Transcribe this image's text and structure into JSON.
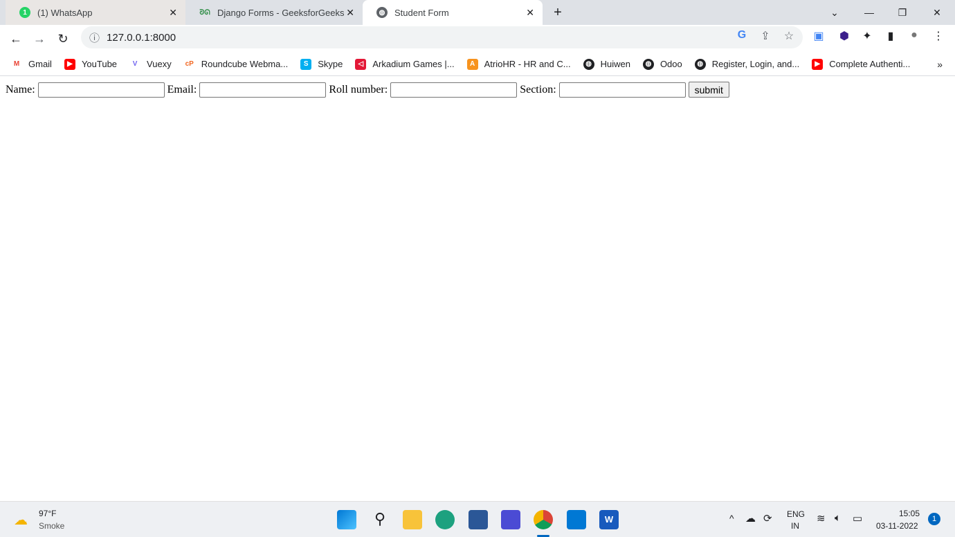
{
  "tabs": [
    {
      "title": "(1) WhatsApp",
      "icon": "whatsapp-icon",
      "badge": "1"
    },
    {
      "title": "Django Forms - GeeksforGeeks",
      "icon": "gfg-icon"
    },
    {
      "title": "Student Form",
      "icon": "globe-icon",
      "active": true
    }
  ],
  "address": {
    "url": "127.0.0.1:8000"
  },
  "bookmarks": [
    {
      "label": "Gmail",
      "color": "#ea4335",
      "glyph": "M"
    },
    {
      "label": "YouTube",
      "color": "#ff0000",
      "glyph": "▶"
    },
    {
      "label": "Vuexy",
      "color": "#7367f0",
      "glyph": "V"
    },
    {
      "label": "Roundcube Webma...",
      "color": "#f26722",
      "glyph": "cP"
    },
    {
      "label": "Skype",
      "color": "#00aff0",
      "glyph": "S"
    },
    {
      "label": "Arkadium Games |...",
      "color": "#e31837",
      "glyph": "◁"
    },
    {
      "label": "AtrioHR - HR and C...",
      "color": "#f7931e",
      "glyph": "A"
    },
    {
      "label": "Huiwen",
      "color": "#202124",
      "glyph": "●"
    },
    {
      "label": "Odoo",
      "color": "#202124",
      "glyph": "●"
    },
    {
      "label": "Register, Login, and...",
      "color": "#202124",
      "glyph": "●"
    },
    {
      "label": "Complete Authenti...",
      "color": "#ff0000",
      "glyph": "▶"
    }
  ],
  "form": {
    "name_label": "Name:",
    "email_label": "Email:",
    "roll_label": "Roll number:",
    "section_label": "Section:",
    "submit_label": "submit"
  },
  "taskbar": {
    "weather_temp": "97°F",
    "weather_desc": "Smoke",
    "lang1": "ENG",
    "lang2": "IN",
    "time": "15:05",
    "date": "03-11-2022",
    "notifications": "1"
  }
}
